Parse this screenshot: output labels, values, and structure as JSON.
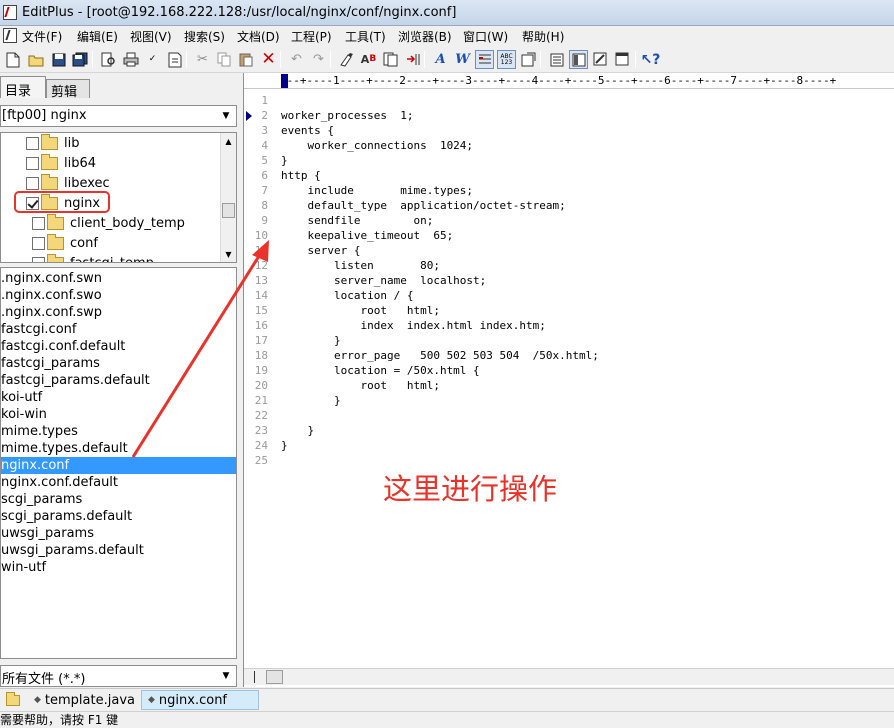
{
  "window": {
    "title": "EditPlus - [root@192.168.222.128:/usr/local/nginx/conf/nginx.conf]"
  },
  "menubar": {
    "items": [
      "文件(F)",
      "编辑(E)",
      "视图(V)",
      "搜索(S)",
      "文档(D)",
      "工程(P)",
      "工具(T)",
      "浏览器(B)",
      "窗口(W)",
      "帮助(H)"
    ]
  },
  "toolbar": {
    "icons": [
      "new-file-icon",
      "open-folder-icon",
      "save-icon",
      "save-all-icon",
      "print-preview-icon",
      "print-icon",
      "spell-check-icon",
      "print-setup-icon",
      "cut-icon",
      "copy-icon",
      "paste-icon",
      "delete-icon",
      "undo-icon",
      "redo-icon",
      "find-icon",
      "replace-icon",
      "find-in-files-icon",
      "goto-icon",
      "font-icon",
      "word-wrap-icon",
      "line-number-icon",
      "ruler-icon",
      "hex-viewer-icon",
      "window-list-icon",
      "output-window-icon",
      "directory-window-icon",
      "cliptext-icon",
      "help-context-icon"
    ],
    "pressed": [
      "line-number-icon",
      "ruler-icon",
      "directory-window-icon"
    ]
  },
  "left_panel": {
    "tabs": [
      "目录",
      "剪辑"
    ],
    "active_tab": "目录",
    "ftp_select": "[ftp00] nginx",
    "tree": [
      {
        "name": "lib",
        "checked": false,
        "indent": 1
      },
      {
        "name": "lib64",
        "checked": false,
        "indent": 1
      },
      {
        "name": "libexec",
        "checked": false,
        "indent": 1
      },
      {
        "name": "nginx",
        "checked": true,
        "indent": 1
      },
      {
        "name": "client_body_temp",
        "checked": false,
        "indent": 2
      },
      {
        "name": "conf",
        "checked": false,
        "indent": 2
      },
      {
        "name": "fastcgi_temp",
        "checked": false,
        "indent": 2
      }
    ],
    "files": [
      ".nginx.conf.swn",
      ".nginx.conf.swo",
      ".nginx.conf.swp",
      "fastcgi.conf",
      "fastcgi.conf.default",
      "fastcgi_params",
      "fastcgi_params.default",
      "koi-utf",
      "koi-win",
      "mime.types",
      "mime.types.default",
      "nginx.conf",
      "nginx.conf.default",
      "scgi_params",
      "scgi_params.default",
      "uwsgi_params",
      "uwsgi_params.default",
      "win-utf"
    ],
    "selected_file": "nginx.conf",
    "filter": "所有文件 (*.*)"
  },
  "editor": {
    "ruler": "---+----1----+----2----+----3----+----4----+----5----+----6----+----7----+----8----+",
    "lines": [
      "",
      "worker_processes  1;",
      "events {",
      "    worker_connections  1024;",
      "}",
      "http {",
      "    include       mime.types;",
      "    default_type  application/octet-stream;",
      "    sendfile        on;",
      "    keepalive_timeout  65;",
      "    server {",
      "        listen       80;",
      "        server_name  localhost;",
      "        location / {",
      "            root   html;",
      "            index  index.html index.htm;",
      "        }",
      "        error_page   500 502 503 504  /50x.html;",
      "        location = /50x.html {",
      "            root   html;",
      "        }",
      "",
      "    }",
      "}",
      ""
    ]
  },
  "doc_tabs": [
    {
      "label": "template.java",
      "active": false
    },
    {
      "label": "nginx.conf",
      "active": true
    }
  ],
  "status": {
    "text": "需要帮助，请按 F1 键"
  },
  "annotation": {
    "text": "这里进行操作",
    "color": "#e8322a"
  }
}
